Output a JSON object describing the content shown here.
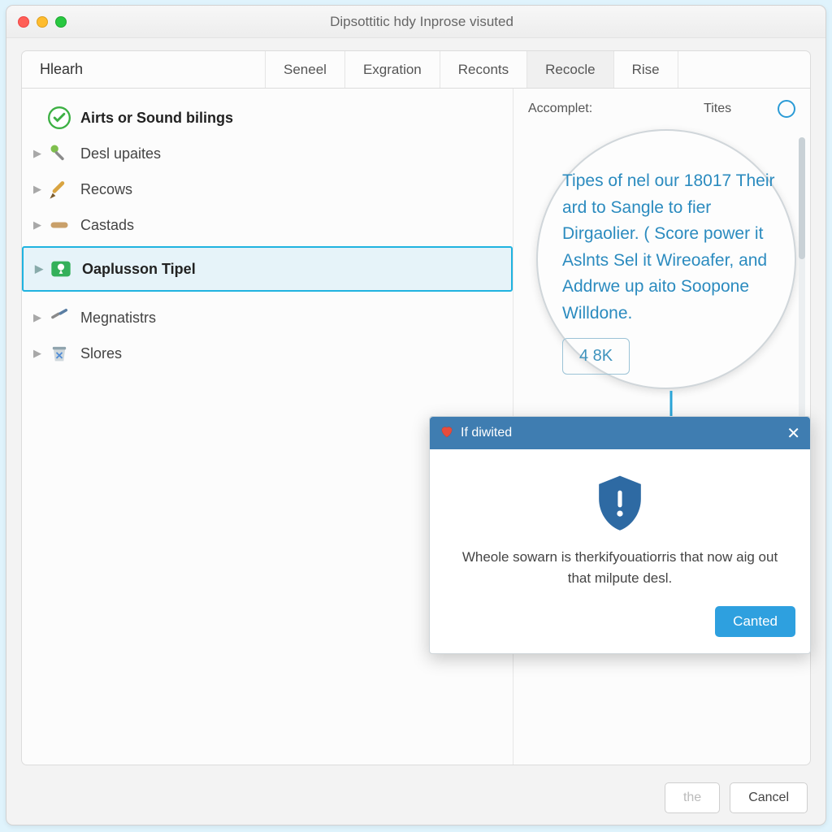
{
  "window": {
    "title": "Dipsottitic hdy Inprose visuted"
  },
  "tabs": {
    "first": "Hlearh",
    "items": [
      "Seneel",
      "Exgration",
      "Reconts",
      "Recocle",
      "Rise"
    ],
    "active_index": 3
  },
  "tree": {
    "header": {
      "label": "Airts or Sound bilings",
      "icon": "check-circle-icon"
    },
    "items": [
      {
        "label": "Desl upaites",
        "icon": "wand-icon"
      },
      {
        "label": "Recows",
        "icon": "pencil-icon"
      },
      {
        "label": "Castads",
        "icon": "tag-icon"
      },
      {
        "label": "Oaplusson Tipel",
        "icon": "location-badge-icon",
        "selected": true
      },
      {
        "label": "Megnatistrs",
        "icon": "screwdriver-icon"
      },
      {
        "label": "Slores",
        "icon": "recycle-bin-icon"
      }
    ]
  },
  "detail": {
    "heading_left": "Accomplet:",
    "heading_right": "Tites",
    "magnifier_text": "Tipes of nel our 18017 Their ard to Sangle to fier Dirgaolier. ( Score power it Aslnts Sel it Wireoafer, and Addrwe up aito Soopone Willdone.",
    "chip": "4 8K"
  },
  "dialog": {
    "title": "If diwited",
    "message": "Wheole sowarn is therkifyouatiorris that now aig out that milpute desl.",
    "confirm": "Canted"
  },
  "footer": {
    "ok": "the",
    "cancel": "Cancel"
  }
}
